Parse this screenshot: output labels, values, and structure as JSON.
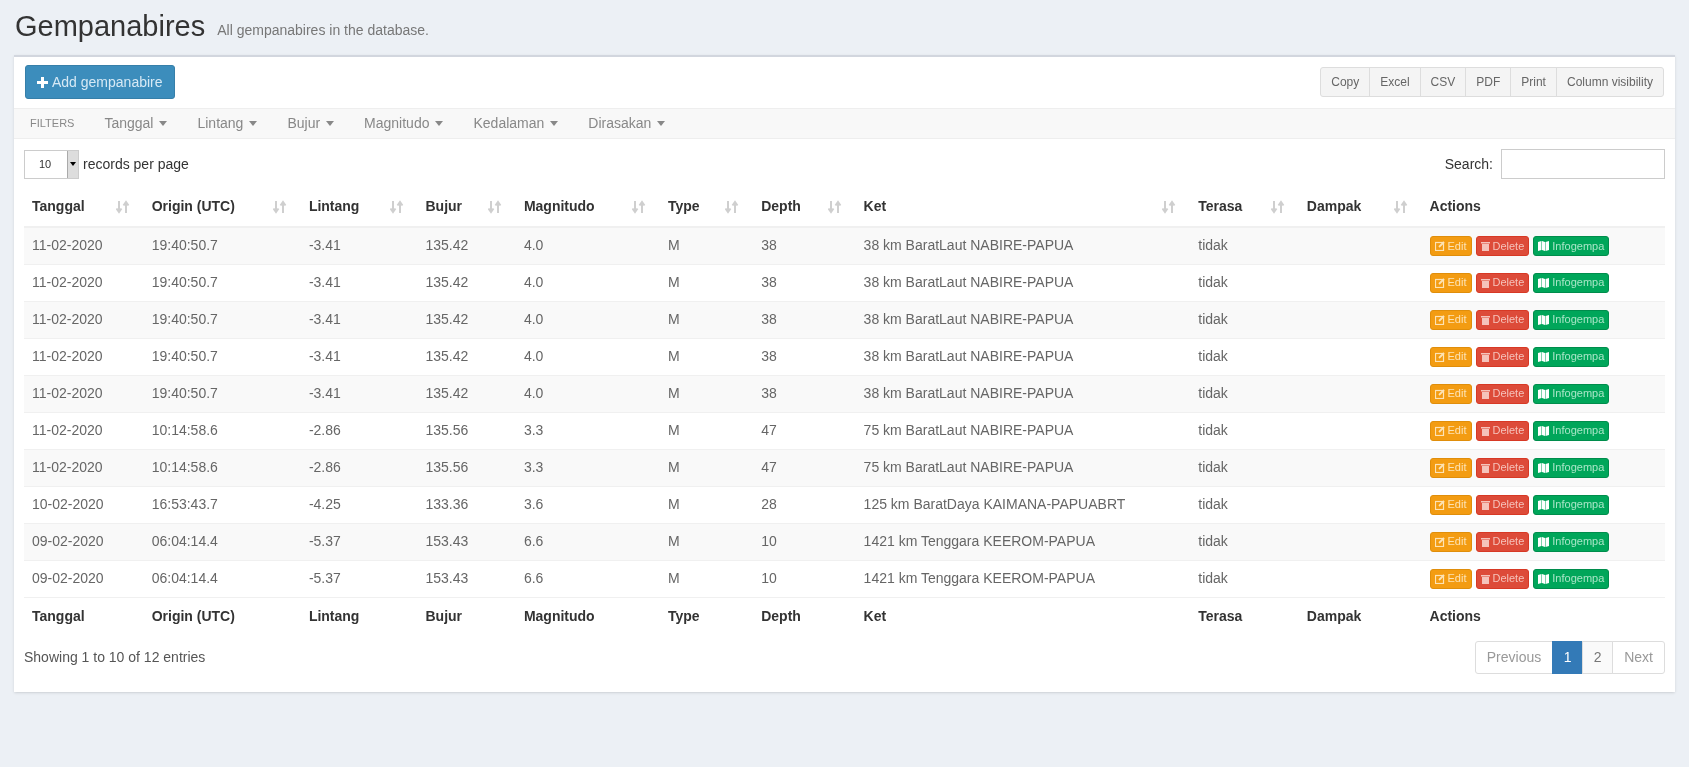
{
  "header": {
    "title": "Gempanabires",
    "subtitle": "All gempanabires in the database."
  },
  "add_button": "Add gempanabire",
  "export_buttons": [
    "Copy",
    "Excel",
    "CSV",
    "PDF",
    "Print",
    "Column visibility"
  ],
  "filters": {
    "label": "FILTERS",
    "items": [
      "Tanggal",
      "Lintang",
      "Bujur",
      "Magnitudo",
      "Kedalaman",
      "Dirasakan"
    ]
  },
  "page_length": {
    "value": "10",
    "label": "records per page"
  },
  "search": {
    "label": "Search:"
  },
  "table": {
    "columns": [
      "Tanggal",
      "Origin (UTC)",
      "Lintang",
      "Bujur",
      "Magnitudo",
      "Type",
      "Depth",
      "Ket",
      "Terasa",
      "Dampak",
      "Actions"
    ],
    "rows": [
      {
        "cells": [
          "11-02-2020",
          "19:40:50.7",
          "-3.41",
          "135.42",
          "4.0",
          "M",
          "38",
          "38 km BaratLaut NABIRE-PAPUA",
          "tidak",
          ""
        ],
        "actions": [
          "Edit",
          "Delete",
          "Infogempa"
        ]
      },
      {
        "cells": [
          "11-02-2020",
          "19:40:50.7",
          "-3.41",
          "135.42",
          "4.0",
          "M",
          "38",
          "38 km BaratLaut NABIRE-PAPUA",
          "tidak",
          ""
        ],
        "actions": [
          "Edit",
          "Delete",
          "Infogempa"
        ]
      },
      {
        "cells": [
          "11-02-2020",
          "19:40:50.7",
          "-3.41",
          "135.42",
          "4.0",
          "M",
          "38",
          "38 km BaratLaut NABIRE-PAPUA",
          "tidak",
          ""
        ],
        "actions": [
          "Edit",
          "Delete",
          "Infogempa"
        ]
      },
      {
        "cells": [
          "11-02-2020",
          "19:40:50.7",
          "-3.41",
          "135.42",
          "4.0",
          "M",
          "38",
          "38 km BaratLaut NABIRE-PAPUA",
          "tidak",
          ""
        ],
        "actions": [
          "Edit",
          "Delete",
          "Infogempa"
        ]
      },
      {
        "cells": [
          "11-02-2020",
          "19:40:50.7",
          "-3.41",
          "135.42",
          "4.0",
          "M",
          "38",
          "38 km BaratLaut NABIRE-PAPUA",
          "tidak",
          ""
        ],
        "actions": [
          "Edit",
          "Delete",
          "Infogempa"
        ]
      },
      {
        "cells": [
          "11-02-2020",
          "10:14:58.6",
          "-2.86",
          "135.56",
          "3.3",
          "M",
          "47",
          "75 km BaratLaut NABIRE-PAPUA",
          "tidak",
          ""
        ],
        "actions": [
          "Edit",
          "Delete",
          "Infogempa"
        ]
      },
      {
        "cells": [
          "11-02-2020",
          "10:14:58.6",
          "-2.86",
          "135.56",
          "3.3",
          "M",
          "47",
          "75 km BaratLaut NABIRE-PAPUA",
          "tidak",
          ""
        ],
        "actions": [
          "Edit",
          "Delete",
          "Infogempa"
        ]
      },
      {
        "cells": [
          "10-02-2020",
          "16:53:43.7",
          "-4.25",
          "133.36",
          "3.6",
          "M",
          "28",
          "125 km BaratDaya KAIMANA-PAPUABRT",
          "tidak",
          ""
        ],
        "actions": [
          "Edit",
          "Delete",
          "Infogempa"
        ]
      },
      {
        "cells": [
          "09-02-2020",
          "06:04:14.4",
          "-5.37",
          "153.43",
          "6.6",
          "M",
          "10",
          "1421 km Tenggara KEEROM-PAPUA",
          "tidak",
          ""
        ],
        "actions": [
          "Edit",
          "Delete",
          "Infogempa"
        ]
      },
      {
        "cells": [
          "09-02-2020",
          "06:04:14.4",
          "-5.37",
          "153.43",
          "6.6",
          "M",
          "10",
          "1421 km Tenggara KEEROM-PAPUA",
          "tidak",
          ""
        ],
        "actions": [
          "Edit",
          "Delete",
          "Infogempa"
        ]
      }
    ],
    "footer_columns": [
      "Tanggal",
      "Origin (UTC)",
      "Lintang",
      "Bujur",
      "Magnitudo",
      "Type",
      "Depth",
      "Ket",
      "Terasa",
      "Dampak",
      "Actions"
    ]
  },
  "info": "Showing 1 to 10 of 12 entries",
  "pagination": {
    "previous": "Previous",
    "next": "Next",
    "pages": [
      {
        "label": "1",
        "selected": true
      },
      {
        "label": "2",
        "selected": false
      }
    ]
  }
}
